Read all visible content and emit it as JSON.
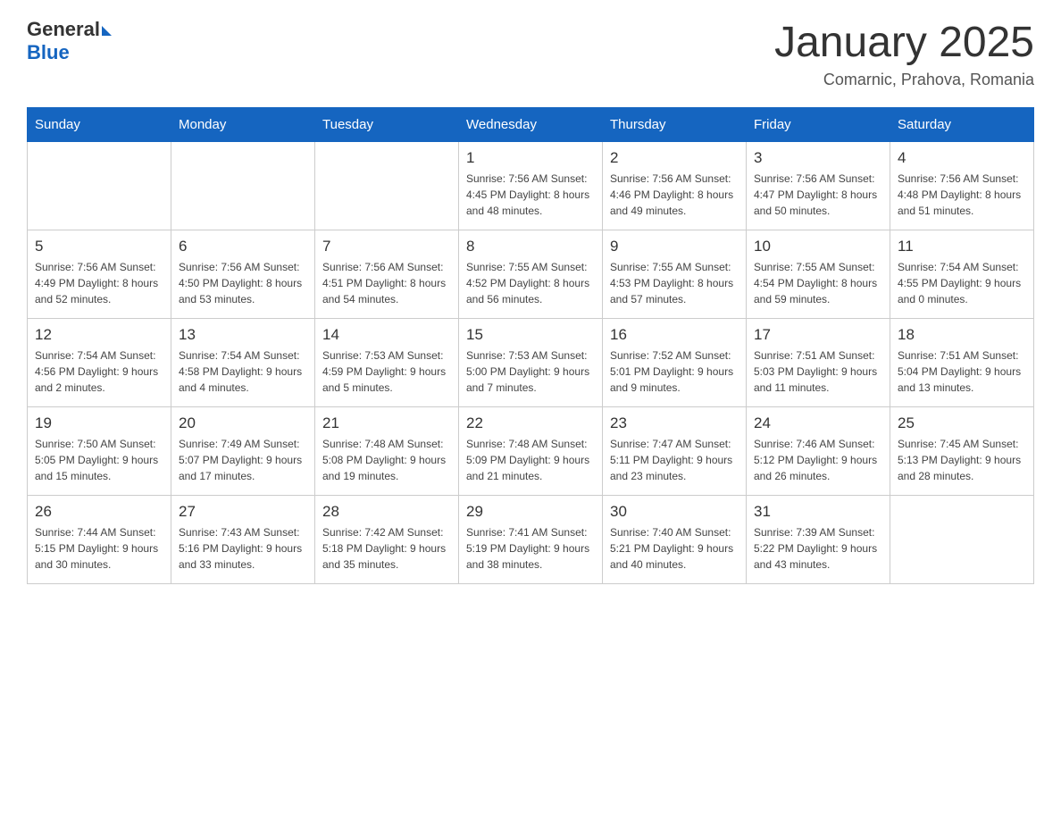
{
  "header": {
    "logo_text_general": "General",
    "logo_text_blue": "Blue",
    "month_title": "January 2025",
    "location": "Comarnic, Prahova, Romania"
  },
  "days_of_week": [
    "Sunday",
    "Monday",
    "Tuesday",
    "Wednesday",
    "Thursday",
    "Friday",
    "Saturday"
  ],
  "weeks": [
    [
      {
        "day": "",
        "info": ""
      },
      {
        "day": "",
        "info": ""
      },
      {
        "day": "",
        "info": ""
      },
      {
        "day": "1",
        "info": "Sunrise: 7:56 AM\nSunset: 4:45 PM\nDaylight: 8 hours\nand 48 minutes."
      },
      {
        "day": "2",
        "info": "Sunrise: 7:56 AM\nSunset: 4:46 PM\nDaylight: 8 hours\nand 49 minutes."
      },
      {
        "day": "3",
        "info": "Sunrise: 7:56 AM\nSunset: 4:47 PM\nDaylight: 8 hours\nand 50 minutes."
      },
      {
        "day": "4",
        "info": "Sunrise: 7:56 AM\nSunset: 4:48 PM\nDaylight: 8 hours\nand 51 minutes."
      }
    ],
    [
      {
        "day": "5",
        "info": "Sunrise: 7:56 AM\nSunset: 4:49 PM\nDaylight: 8 hours\nand 52 minutes."
      },
      {
        "day": "6",
        "info": "Sunrise: 7:56 AM\nSunset: 4:50 PM\nDaylight: 8 hours\nand 53 minutes."
      },
      {
        "day": "7",
        "info": "Sunrise: 7:56 AM\nSunset: 4:51 PM\nDaylight: 8 hours\nand 54 minutes."
      },
      {
        "day": "8",
        "info": "Sunrise: 7:55 AM\nSunset: 4:52 PM\nDaylight: 8 hours\nand 56 minutes."
      },
      {
        "day": "9",
        "info": "Sunrise: 7:55 AM\nSunset: 4:53 PM\nDaylight: 8 hours\nand 57 minutes."
      },
      {
        "day": "10",
        "info": "Sunrise: 7:55 AM\nSunset: 4:54 PM\nDaylight: 8 hours\nand 59 minutes."
      },
      {
        "day": "11",
        "info": "Sunrise: 7:54 AM\nSunset: 4:55 PM\nDaylight: 9 hours\nand 0 minutes."
      }
    ],
    [
      {
        "day": "12",
        "info": "Sunrise: 7:54 AM\nSunset: 4:56 PM\nDaylight: 9 hours\nand 2 minutes."
      },
      {
        "day": "13",
        "info": "Sunrise: 7:54 AM\nSunset: 4:58 PM\nDaylight: 9 hours\nand 4 minutes."
      },
      {
        "day": "14",
        "info": "Sunrise: 7:53 AM\nSunset: 4:59 PM\nDaylight: 9 hours\nand 5 minutes."
      },
      {
        "day": "15",
        "info": "Sunrise: 7:53 AM\nSunset: 5:00 PM\nDaylight: 9 hours\nand 7 minutes."
      },
      {
        "day": "16",
        "info": "Sunrise: 7:52 AM\nSunset: 5:01 PM\nDaylight: 9 hours\nand 9 minutes."
      },
      {
        "day": "17",
        "info": "Sunrise: 7:51 AM\nSunset: 5:03 PM\nDaylight: 9 hours\nand 11 minutes."
      },
      {
        "day": "18",
        "info": "Sunrise: 7:51 AM\nSunset: 5:04 PM\nDaylight: 9 hours\nand 13 minutes."
      }
    ],
    [
      {
        "day": "19",
        "info": "Sunrise: 7:50 AM\nSunset: 5:05 PM\nDaylight: 9 hours\nand 15 minutes."
      },
      {
        "day": "20",
        "info": "Sunrise: 7:49 AM\nSunset: 5:07 PM\nDaylight: 9 hours\nand 17 minutes."
      },
      {
        "day": "21",
        "info": "Sunrise: 7:48 AM\nSunset: 5:08 PM\nDaylight: 9 hours\nand 19 minutes."
      },
      {
        "day": "22",
        "info": "Sunrise: 7:48 AM\nSunset: 5:09 PM\nDaylight: 9 hours\nand 21 minutes."
      },
      {
        "day": "23",
        "info": "Sunrise: 7:47 AM\nSunset: 5:11 PM\nDaylight: 9 hours\nand 23 minutes."
      },
      {
        "day": "24",
        "info": "Sunrise: 7:46 AM\nSunset: 5:12 PM\nDaylight: 9 hours\nand 26 minutes."
      },
      {
        "day": "25",
        "info": "Sunrise: 7:45 AM\nSunset: 5:13 PM\nDaylight: 9 hours\nand 28 minutes."
      }
    ],
    [
      {
        "day": "26",
        "info": "Sunrise: 7:44 AM\nSunset: 5:15 PM\nDaylight: 9 hours\nand 30 minutes."
      },
      {
        "day": "27",
        "info": "Sunrise: 7:43 AM\nSunset: 5:16 PM\nDaylight: 9 hours\nand 33 minutes."
      },
      {
        "day": "28",
        "info": "Sunrise: 7:42 AM\nSunset: 5:18 PM\nDaylight: 9 hours\nand 35 minutes."
      },
      {
        "day": "29",
        "info": "Sunrise: 7:41 AM\nSunset: 5:19 PM\nDaylight: 9 hours\nand 38 minutes."
      },
      {
        "day": "30",
        "info": "Sunrise: 7:40 AM\nSunset: 5:21 PM\nDaylight: 9 hours\nand 40 minutes."
      },
      {
        "day": "31",
        "info": "Sunrise: 7:39 AM\nSunset: 5:22 PM\nDaylight: 9 hours\nand 43 minutes."
      },
      {
        "day": "",
        "info": ""
      }
    ]
  ]
}
